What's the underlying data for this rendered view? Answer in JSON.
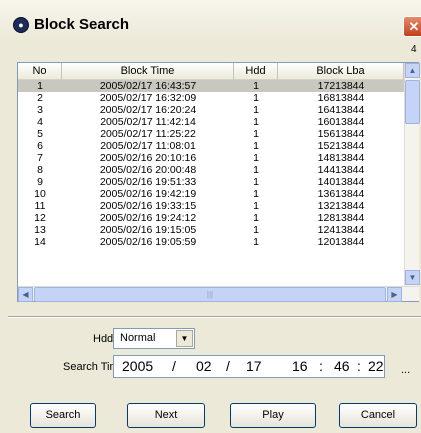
{
  "window": {
    "title": "Block Search",
    "close_glyph": "✕",
    "corner_text": "4"
  },
  "table": {
    "columns": [
      "No",
      "Block Time",
      "Hdd",
      "Block Lba"
    ],
    "rows": [
      {
        "no": "1",
        "time": "2005/02/17 16:43:57",
        "hdd": "1",
        "lba": "17213844"
      },
      {
        "no": "2",
        "time": "2005/02/17 16:32:09",
        "hdd": "1",
        "lba": "16813844"
      },
      {
        "no": "3",
        "time": "2005/02/17 16:20:24",
        "hdd": "1",
        "lba": "16413844"
      },
      {
        "no": "4",
        "time": "2005/02/17 11:42:14",
        "hdd": "1",
        "lba": "16013844"
      },
      {
        "no": "5",
        "time": "2005/02/17 11:25:22",
        "hdd": "1",
        "lba": "15613844"
      },
      {
        "no": "6",
        "time": "2005/02/17 11:08:01",
        "hdd": "1",
        "lba": "15213844"
      },
      {
        "no": "7",
        "time": "2005/02/16 20:10:16",
        "hdd": "1",
        "lba": "14813844"
      },
      {
        "no": "8",
        "time": "2005/02/16 20:00:48",
        "hdd": "1",
        "lba": "14413844"
      },
      {
        "no": "9",
        "time": "2005/02/16 19:51:33",
        "hdd": "1",
        "lba": "14013844"
      },
      {
        "no": "10",
        "time": "2005/02/16 19:42:19",
        "hdd": "1",
        "lba": "13613844"
      },
      {
        "no": "11",
        "time": "2005/02/16 19:33:15",
        "hdd": "1",
        "lba": "13213844"
      },
      {
        "no": "12",
        "time": "2005/02/16 19:24:12",
        "hdd": "1",
        "lba": "12813844"
      },
      {
        "no": "13",
        "time": "2005/02/16 19:15:05",
        "hdd": "1",
        "lba": "12413844"
      },
      {
        "no": "14",
        "time": "2005/02/16 19:05:59",
        "hdd": "1",
        "lba": "12013844"
      }
    ],
    "selected_row": 0
  },
  "icons": {
    "scroll_up": "▲",
    "scroll_down": "▼",
    "scroll_left": "◀",
    "scroll_right": "▶",
    "grip": "|||",
    "dropdown": "▼"
  },
  "form": {
    "hdd_label": "Hdd :",
    "hdd_value": "Normal",
    "search_time_label": "Search Time :",
    "search_time": {
      "year": "2005",
      "sep1": "/",
      "month": "02",
      "sep2": "/",
      "day": "17",
      "hour": "16",
      "sep3": ":",
      "minute": "46",
      "sep4": ":",
      "second": "22"
    },
    "ellipsis": "..."
  },
  "buttons": {
    "search": "Search",
    "next": "Next",
    "play": "Play",
    "cancel": "Cancel"
  }
}
